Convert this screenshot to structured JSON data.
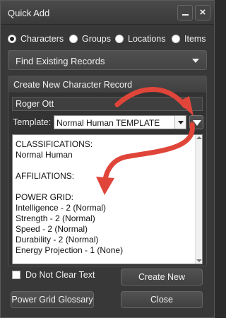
{
  "window": {
    "title": "Quick Add"
  },
  "titlebar": {
    "minimize_glyph": "",
    "close_glyph": "×"
  },
  "record_types": [
    {
      "label": "Characters",
      "selected": true
    },
    {
      "label": "Groups",
      "selected": false
    },
    {
      "label": "Locations",
      "selected": false
    },
    {
      "label": "Items",
      "selected": false
    }
  ],
  "find": {
    "label": "Find Existing Records"
  },
  "create_panel": {
    "header": "Create New Character Record",
    "name_value": "Roger Ott",
    "template_label": "Template:",
    "template_value": "Normal Human TEMPLATE",
    "description": "CLASSIFICATIONS:\nNormal Human\n\nAFFILIATIONS:\n\nPOWER GRID:\nIntelligence - 2 (Normal)\nStrength - 2 (Normal)\nSpeed - 2 (Normal)\nDurability - 2 (Normal)\nEnergy Projection - 1 (None)"
  },
  "options": {
    "do_not_clear_label": "Do Not Clear Text",
    "do_not_clear_checked": false
  },
  "buttons": {
    "create_new": "Create New",
    "glossary": "Power Grid Glossary",
    "close": "Close"
  },
  "colors": {
    "annotation_arrow": "#e0453a",
    "window_bg": "#383838"
  },
  "icons": {
    "dropdown": "chevron-down-icon",
    "template_apply": "triangle-down-icon"
  }
}
